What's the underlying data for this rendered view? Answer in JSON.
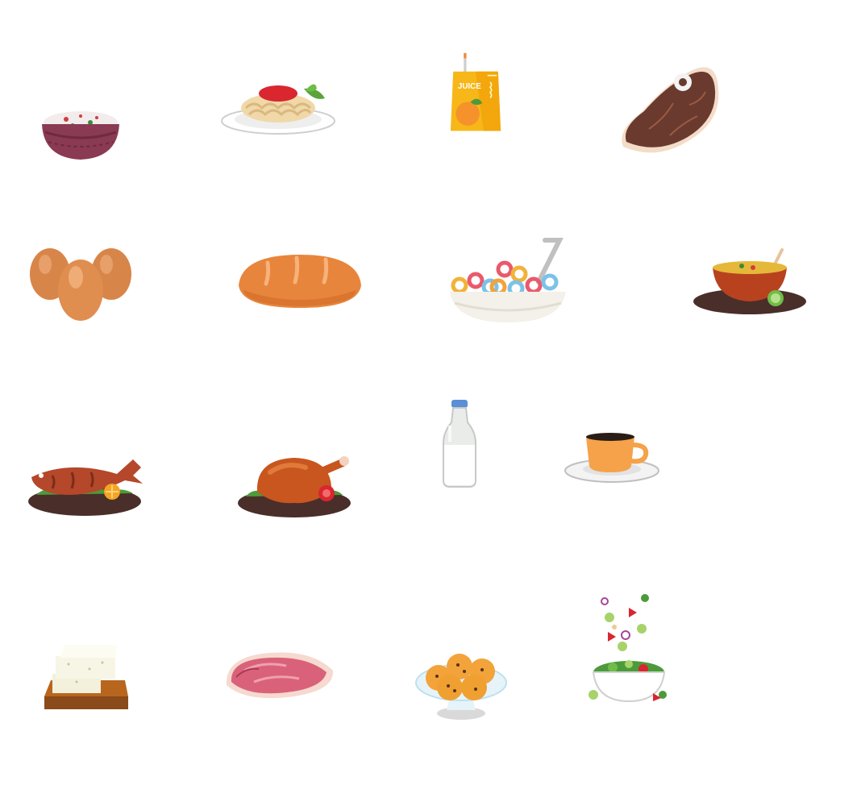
{
  "items": [
    {
      "id": "rice",
      "icon": "rice-bowl-icon"
    },
    {
      "id": "spaghetti",
      "icon": "spaghetti-plate-icon"
    },
    {
      "id": "juice",
      "icon": "juice-box-icon",
      "label": "JUICE"
    },
    {
      "id": "steak",
      "icon": "steak-icon"
    },
    {
      "id": "eggs",
      "icon": "eggs-icon"
    },
    {
      "id": "bread",
      "icon": "bread-loaf-icon"
    },
    {
      "id": "cereal",
      "icon": "cereal-bowl-icon"
    },
    {
      "id": "soup",
      "icon": "soup-bowl-icon"
    },
    {
      "id": "fish",
      "icon": "grilled-fish-icon"
    },
    {
      "id": "chicken",
      "icon": "roast-chicken-icon"
    },
    {
      "id": "milk",
      "icon": "milk-bottle-icon"
    },
    {
      "id": "coffee",
      "icon": "coffee-cup-icon"
    },
    {
      "id": "tofu",
      "icon": "tofu-board-icon"
    },
    {
      "id": "pork",
      "icon": "pork-chop-icon"
    },
    {
      "id": "cookies",
      "icon": "cookies-plate-icon"
    },
    {
      "id": "salad",
      "icon": "salad-bowl-icon"
    }
  ],
  "colors": {
    "background": "#ffffff",
    "juice_yellow": "#f7b718",
    "orange": "#f5922b",
    "plate_dark": "#4a2e2a",
    "meat_brown": "#6b3a2e",
    "bread": "#e8853c"
  }
}
